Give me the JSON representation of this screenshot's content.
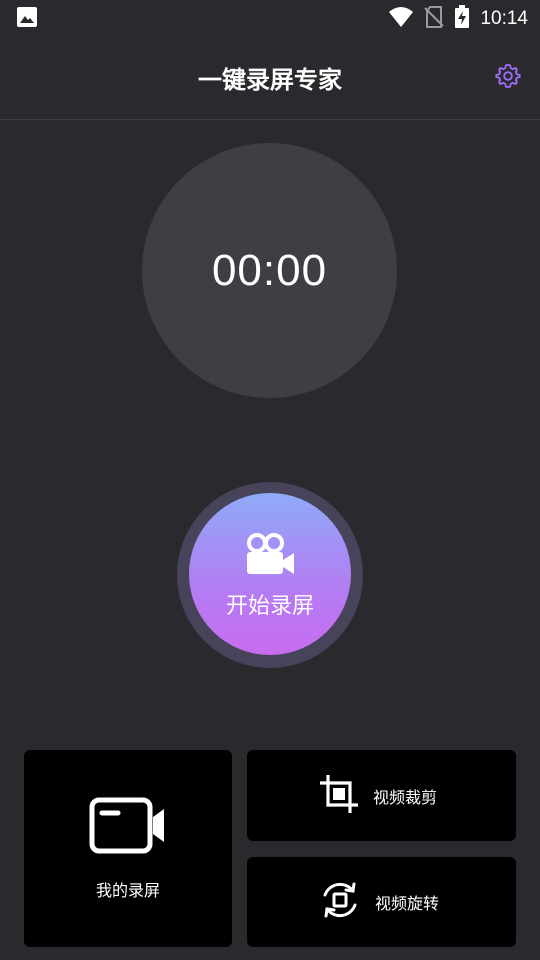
{
  "status_bar": {
    "time": "10:14",
    "icons": [
      "image-notification-icon",
      "wifi-icon",
      "no-sim-icon",
      "battery-charging-icon"
    ]
  },
  "app_bar": {
    "title": "一键录屏专家",
    "settings_icon": "gear-icon"
  },
  "timer": {
    "value": "00:00"
  },
  "record_button": {
    "label": "开始录屏",
    "icon": "video-camera-icon"
  },
  "cards": {
    "my_recordings": {
      "label": "我的录屏",
      "icon": "screen-video-icon"
    },
    "video_crop": {
      "label": "视频裁剪",
      "icon": "crop-icon"
    },
    "video_rotate": {
      "label": "视频旋转",
      "icon": "rotate-icon"
    }
  },
  "colors": {
    "background": "#2a2a2e",
    "timer_circle": "#3f3e44",
    "accent": "#9b6ef3",
    "gradient_top": "#8faaf8",
    "gradient_bottom": "#c86cf0",
    "card": "#000000"
  }
}
